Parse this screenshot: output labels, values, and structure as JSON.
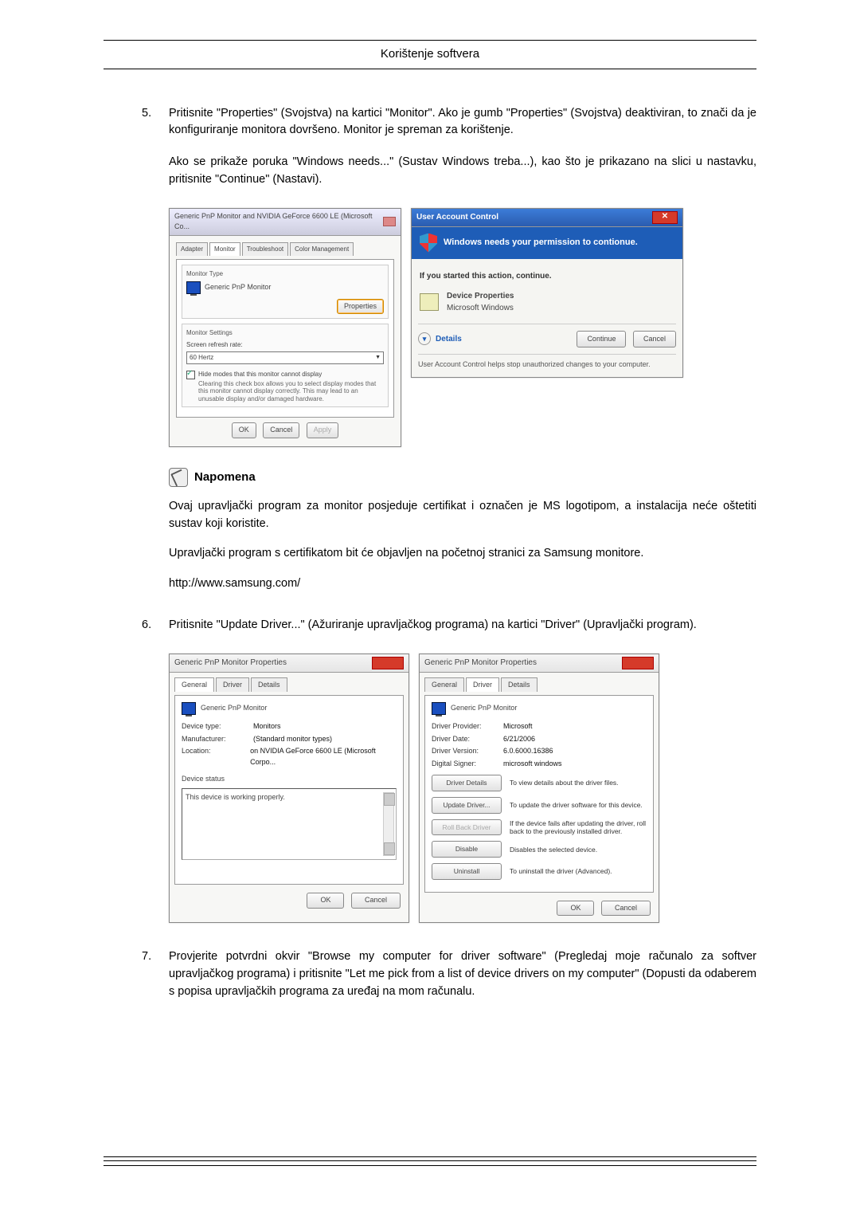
{
  "header": {
    "title": "Korištenje softvera"
  },
  "step5": {
    "num": "5.",
    "para1": "Pritisnite \"Properties\" (Svojstva) na kartici \"Monitor\". Ako je gumb \"Properties\" (Svojstva) deaktiviran, to znači da je konfiguriranje monitora dovršeno. Monitor je spreman za korištenje.",
    "para2": "Ako se prikaže poruka \"Windows needs...\" (Sustav Windows treba...), kao što je prikazano na slici u nastavku, pritisnite \"Continue\" (Nastavi)."
  },
  "dlg1": {
    "title": "Generic PnP Monitor and NVIDIA GeForce 6600 LE (Microsoft Co...",
    "tabs": [
      "Adapter",
      "Monitor",
      "Troubleshoot",
      "Color Management"
    ],
    "sec1_title": "Monitor Type",
    "monitor_name": "Generic PnP Monitor",
    "properties_btn": "Properties",
    "sec2_title": "Monitor Settings",
    "refresh_label": "Screen refresh rate:",
    "refresh_value": "60 Hertz",
    "hide_label": "Hide modes that this monitor cannot display",
    "hide_desc": "Clearing this check box allows you to select display modes that this monitor cannot display correctly. This may lead to an unusable display and/or damaged hardware.",
    "ok": "OK",
    "cancel": "Cancel",
    "apply": "Apply"
  },
  "uac": {
    "title": "User Account Control",
    "band": "Windows needs your permission to contionue.",
    "hint": "If you started this action, continue.",
    "dev_line1": "Device Properties",
    "dev_line2": "Microsoft Windows",
    "details": "Details",
    "continue": "Continue",
    "cancel": "Cancel",
    "footer": "User Account Control helps stop unauthorized changes to your computer."
  },
  "note": {
    "heading": "Napomena",
    "p1": "Ovaj upravljački program za monitor posjeduje certifikat i označen je MS logotipom, a instalacija neće oštetiti sustav koji koristite.",
    "p2": "Upravljački program s certifikatom bit će objavljen na početnoj stranici za Samsung monitore.",
    "url": "http://www.samsung.com/"
  },
  "step6": {
    "num": "6.",
    "text": "Pritisnite \"Update Driver...\" (Ažuriranje upravljačkog programa) na kartici \"Driver\" (Upravljački program)."
  },
  "props_general": {
    "title": "Generic PnP Monitor Properties",
    "tabs": [
      "General",
      "Driver",
      "Details"
    ],
    "monitor_name": "Generic PnP Monitor",
    "kv": [
      {
        "k": "Device type:",
        "v": "Monitors"
      },
      {
        "k": "Manufacturer:",
        "v": "(Standard monitor types)"
      },
      {
        "k": "Location:",
        "v": "on NVIDIA GeForce 6600 LE (Microsoft Corpo..."
      }
    ],
    "status_label": "Device status",
    "status_text": "This device is working properly.",
    "ok": "OK",
    "cancel": "Cancel"
  },
  "props_driver": {
    "title": "Generic PnP Monitor Properties",
    "tabs": [
      "General",
      "Driver",
      "Details"
    ],
    "monitor_name": "Generic PnP Monitor",
    "kv": [
      {
        "k": "Driver Provider:",
        "v": "Microsoft"
      },
      {
        "k": "Driver Date:",
        "v": "6/21/2006"
      },
      {
        "k": "Driver Version:",
        "v": "6.0.6000.16386"
      },
      {
        "k": "Digital Signer:",
        "v": "microsoft windows"
      }
    ],
    "btns": [
      {
        "label": "Driver Details",
        "desc": "To view details about the driver files."
      },
      {
        "label": "Update Driver...",
        "desc": "To update the driver software for this device."
      },
      {
        "label": "Roll Back Driver",
        "desc": "If the device fails after updating the driver, roll back to the previously installed driver."
      },
      {
        "label": "Disable",
        "desc": "Disables the selected device."
      },
      {
        "label": "Uninstall",
        "desc": "To uninstall the driver (Advanced)."
      }
    ],
    "ok": "OK",
    "cancel": "Cancel"
  },
  "step7": {
    "num": "7.",
    "text": "Provjerite potvrdni okvir \"Browse my computer for driver software\" (Pregledaj moje računalo za softver upravljačkog programa) i pritisnite \"Let me pick from a list of device drivers on my computer\" (Dopusti da odaberem s popisa upravljačkih programa za uređaj na mom računalu."
  }
}
